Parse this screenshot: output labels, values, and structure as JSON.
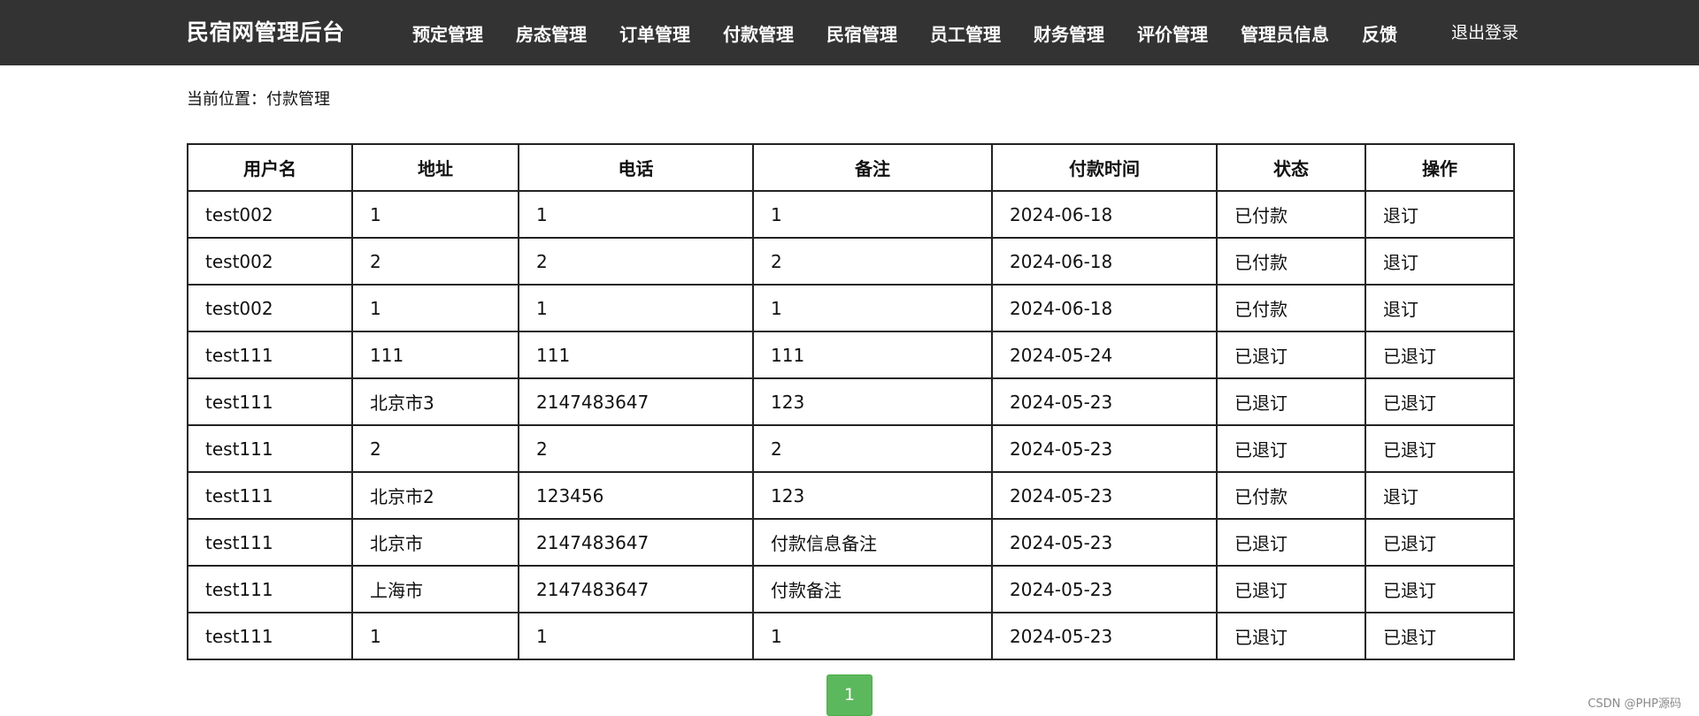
{
  "header": {
    "brand": "民宿网管理后台",
    "nav": [
      {
        "label": "预定管理"
      },
      {
        "label": "房态管理"
      },
      {
        "label": "订单管理"
      },
      {
        "label": "付款管理"
      },
      {
        "label": "民宿管理"
      },
      {
        "label": "员工管理"
      },
      {
        "label": "财务管理"
      },
      {
        "label": "评价管理"
      },
      {
        "label": "管理员信息"
      },
      {
        "label": "反馈"
      }
    ],
    "logout": "退出登录"
  },
  "breadcrumb": "当前位置：付款管理",
  "table": {
    "headers": [
      "用户名",
      "地址",
      "电话",
      "备注",
      "付款时间",
      "状态",
      "操作"
    ],
    "rows": [
      {
        "username": "test002",
        "address": "1",
        "phone": "1",
        "remark": "1",
        "time": "2024-06-18",
        "status": "已付款",
        "action": "退订",
        "action_link": true
      },
      {
        "username": "test002",
        "address": "2",
        "phone": "2",
        "remark": "2",
        "time": "2024-06-18",
        "status": "已付款",
        "action": "退订",
        "action_link": true
      },
      {
        "username": "test002",
        "address": "1",
        "phone": "1",
        "remark": "1",
        "time": "2024-06-18",
        "status": "已付款",
        "action": "退订",
        "action_link": true
      },
      {
        "username": "test111",
        "address": "111",
        "phone": "111",
        "remark": "111",
        "time": "2024-05-24",
        "status": "已退订",
        "action": "已退订",
        "action_link": false
      },
      {
        "username": "test111",
        "address": "北京市3",
        "phone": "2147483647",
        "remark": "123",
        "time": "2024-05-23",
        "status": "已退订",
        "action": "已退订",
        "action_link": false
      },
      {
        "username": "test111",
        "address": "2",
        "phone": "2",
        "remark": "2",
        "time": "2024-05-23",
        "status": "已退订",
        "action": "已退订",
        "action_link": false
      },
      {
        "username": "test111",
        "address": "北京市2",
        "phone": "123456",
        "remark": "123",
        "time": "2024-05-23",
        "status": "已付款",
        "action": "退订",
        "action_link": true
      },
      {
        "username": "test111",
        "address": "北京市",
        "phone": "2147483647",
        "remark": "付款信息备注",
        "time": "2024-05-23",
        "status": "已退订",
        "action": "已退订",
        "action_link": false
      },
      {
        "username": "test111",
        "address": "上海市",
        "phone": "2147483647",
        "remark": "付款备注",
        "time": "2024-05-23",
        "status": "已退订",
        "action": "已退订",
        "action_link": false
      },
      {
        "username": "test111",
        "address": "1",
        "phone": "1",
        "remark": "1",
        "time": "2024-05-23",
        "status": "已退订",
        "action": "已退订",
        "action_link": false
      }
    ]
  },
  "pagination": {
    "current": "1"
  },
  "watermark": "CSDN @PHP源码",
  "colors": {
    "topbar": "#333333",
    "pager": "#5cb85c"
  }
}
